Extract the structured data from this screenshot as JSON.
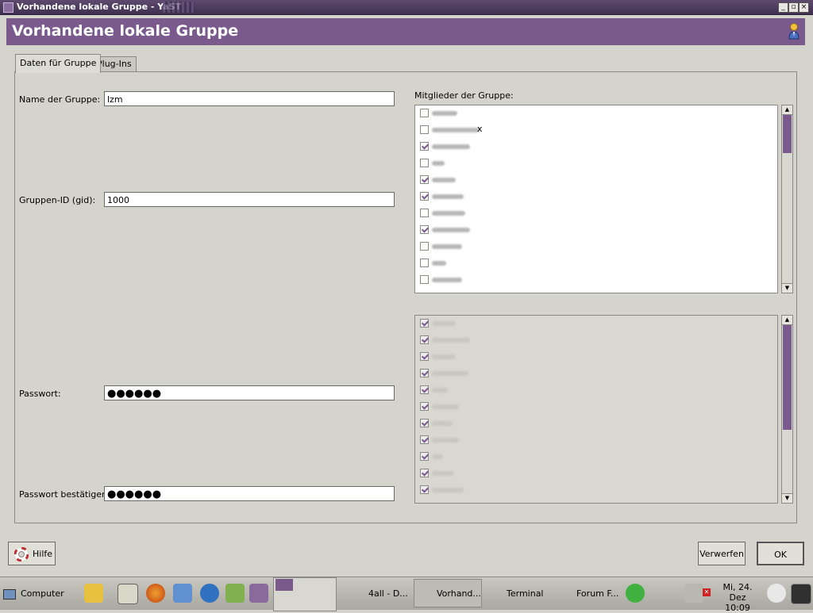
{
  "window": {
    "title": "Vorhandene lokale Gruppe - YaST",
    "buttons": [
      "_",
      "▫",
      "×"
    ]
  },
  "header": {
    "title": "Vorhandene lokale Gruppe"
  },
  "tabs": [
    {
      "label": "Daten für Gruppe"
    },
    {
      "label": "Plug-Ins"
    }
  ],
  "form": {
    "group_name_label": "Name der Gruppe:",
    "group_name_value": "lzm",
    "gid_label": "Gruppen-ID (gid):",
    "gid_value": "1000",
    "password_label": "Passwort:",
    "password_value": "●●●●●●",
    "confirm_label": "Passwort bestätigen:",
    "confirm_value": "●●●●●●"
  },
  "members": {
    "label": "Mitglieder der Gruppe:",
    "list1": [
      false,
      false,
      true,
      false,
      true,
      true,
      false,
      true,
      false,
      false,
      false
    ],
    "list2": [
      true,
      true,
      true,
      true,
      true,
      true,
      true,
      true,
      true,
      true,
      true
    ],
    "list1_suffix": "x"
  },
  "buttons": {
    "help": "Hilfe",
    "discard": "Verwerfen",
    "ok": "OK"
  },
  "taskbar": {
    "computer": "Computer",
    "tasks": [
      "4all - D...",
      "Vorhand...",
      "Terminal",
      "Forum F..."
    ],
    "clock_date": "Mi, 24. Dez",
    "clock_time": "10:09"
  },
  "colors": {
    "accent": "#7a5a8c",
    "titlebar": "#4a3a5c"
  }
}
